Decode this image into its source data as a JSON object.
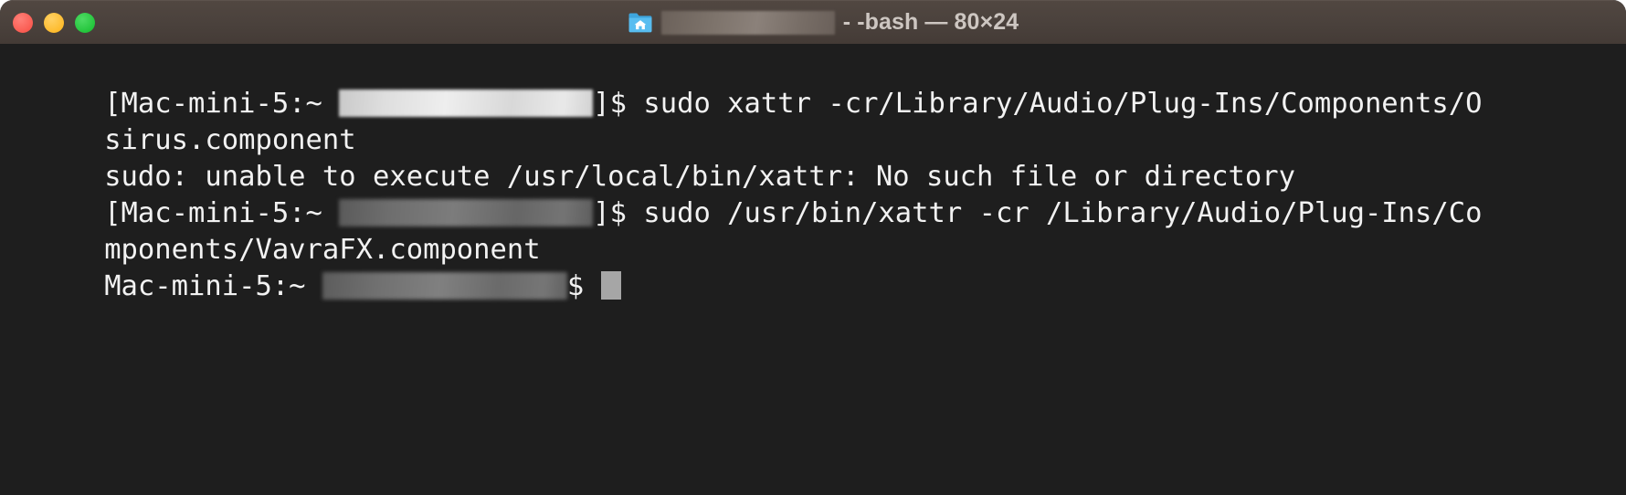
{
  "window": {
    "title_text": "- -bash — 80×24",
    "folder_icon": "home-folder-icon",
    "traffic_lights": {
      "close_label": "Close",
      "minimize_label": "Minimize",
      "maximize_label": "Maximize",
      "close_color": "#fa5c52",
      "minimize_color": "#febc2e",
      "maximize_color": "#24c53c"
    },
    "titlebar_color": "#4a413c",
    "background_color": "#1e1e1e",
    "text_color": "#f2f2f2"
  },
  "terminal": {
    "columns": 80,
    "rows": 24,
    "lines": [
      {
        "id": "prompt-line-1",
        "type": "prompt",
        "prefix": "[Mac-mini-5:~ ",
        "redacted_user": true,
        "suffix": "]$ sudo xattr -cr/Library/Audio/Plug-Ins/Components/O"
      },
      {
        "id": "wrap-line-1",
        "type": "wrap",
        "text": "sirus.component"
      },
      {
        "id": "output-line-1",
        "type": "output",
        "text": "sudo: unable to execute /usr/local/bin/xattr: No such file or directory"
      },
      {
        "id": "prompt-line-2",
        "type": "prompt",
        "prefix": "[Mac-mini-5:~ ",
        "redacted_user": true,
        "suffix": "]$ sudo /usr/bin/xattr -cr /Library/Audio/Plug-Ins/Co"
      },
      {
        "id": "wrap-line-2",
        "type": "wrap",
        "text": "mponents/VavraFX.component"
      },
      {
        "id": "prompt-line-3",
        "type": "prompt",
        "prefix": "Mac-mini-5:~ ",
        "redacted_user": true,
        "suffix": "$ ",
        "cursor": true
      }
    ]
  }
}
